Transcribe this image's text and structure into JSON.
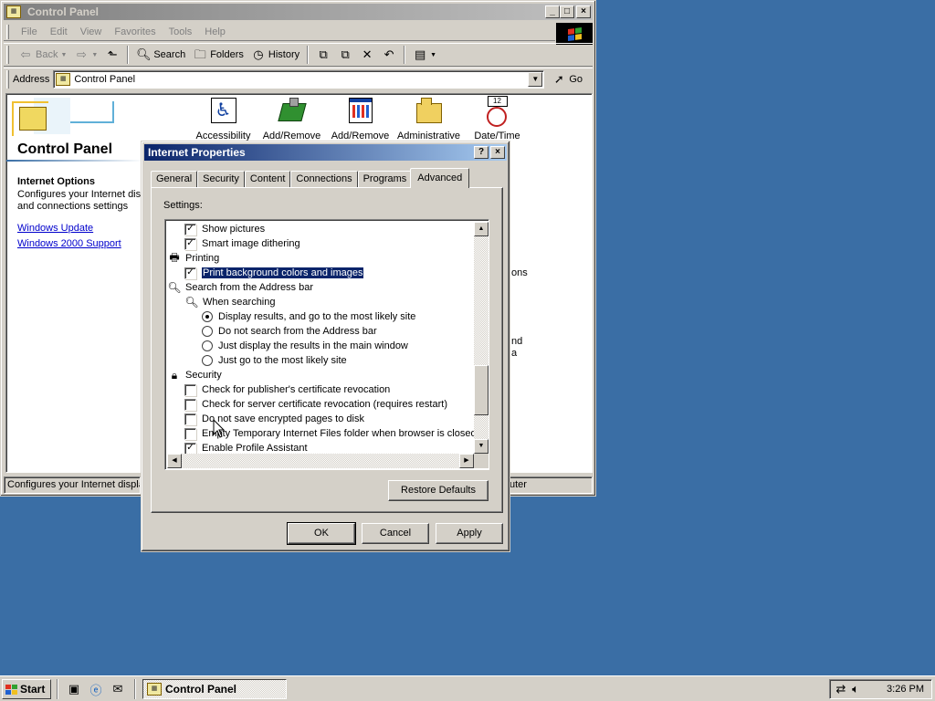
{
  "control_panel": {
    "title": "Control Panel",
    "menu": [
      "File",
      "Edit",
      "View",
      "Favorites",
      "Tools",
      "Help"
    ],
    "toolbar": {
      "back": "Back",
      "search": "Search",
      "folders": "Folders",
      "history": "History"
    },
    "address_label": "Address",
    "address_value": "Control Panel",
    "go_label": "Go",
    "panel_title": "Control Panel",
    "selected_item_title": "Internet Options",
    "selected_item_desc_1": "Configures your Internet dis",
    "selected_item_desc_2": "and connections settings",
    "links": [
      "Windows Update",
      "Windows 2000 Support"
    ],
    "icons": [
      "Accessibility",
      "Add/Remove",
      "Add/Remove",
      "Administrative",
      "Date/Time"
    ],
    "behind_text": [
      "ons",
      "nd",
      "a"
    ],
    "status_left": "Configures your Internet displa",
    "status_right": "uter"
  },
  "dialog": {
    "title": "Internet Properties",
    "tabs": [
      "General",
      "Security",
      "Content",
      "Connections",
      "Programs",
      "Advanced"
    ],
    "active_tab": "Advanced",
    "settings_label": "Settings:",
    "rows": [
      {
        "kind": "check",
        "checked": true,
        "label": "Show pictures",
        "indent": 1
      },
      {
        "kind": "check",
        "checked": true,
        "label": "Smart image dithering",
        "indent": 1
      },
      {
        "kind": "group",
        "icon": "printer-icon",
        "label": "Printing",
        "indent": 0
      },
      {
        "kind": "check",
        "checked": true,
        "label": "Print background colors and images",
        "indent": 1,
        "selected": true
      },
      {
        "kind": "group",
        "icon": "magnifier-icon",
        "label": "Search from the Address bar",
        "indent": 0
      },
      {
        "kind": "group",
        "icon": "magnifier-icon",
        "label": "When searching",
        "indent": 1
      },
      {
        "kind": "radio",
        "checked": true,
        "label": "Display results, and go to the most likely site",
        "indent": 2
      },
      {
        "kind": "radio",
        "checked": false,
        "label": "Do not search from the Address bar",
        "indent": 2
      },
      {
        "kind": "radio",
        "checked": false,
        "label": "Just display the results in the main window",
        "indent": 2
      },
      {
        "kind": "radio",
        "checked": false,
        "label": "Just go to the most likely site",
        "indent": 2
      },
      {
        "kind": "group",
        "icon": "lock-icon",
        "label": "Security",
        "indent": 0
      },
      {
        "kind": "check",
        "checked": false,
        "label": "Check for publisher's certificate revocation",
        "indent": 1
      },
      {
        "kind": "check",
        "checked": false,
        "label": "Check for server certificate revocation (requires restart)",
        "indent": 1
      },
      {
        "kind": "check",
        "checked": false,
        "label": "Do not save encrypted pages to disk",
        "indent": 1
      },
      {
        "kind": "check",
        "checked": false,
        "label": "Empty Temporary Internet Files folder when browser is closed",
        "indent": 1
      },
      {
        "kind": "check",
        "checked": true,
        "label": "Enable Profile Assistant",
        "indent": 1
      }
    ],
    "restore_defaults": "Restore Defaults",
    "ok": "OK",
    "cancel": "Cancel",
    "apply": "Apply",
    "help_glyph": "?",
    "close_glyph": "×"
  },
  "taskbar": {
    "start": "Start",
    "task": "Control Panel",
    "clock": "3:26 PM"
  },
  "colors": {
    "desktop": "#3a6ea5",
    "active_title": "#0a246a",
    "face": "#d4d0c8"
  }
}
